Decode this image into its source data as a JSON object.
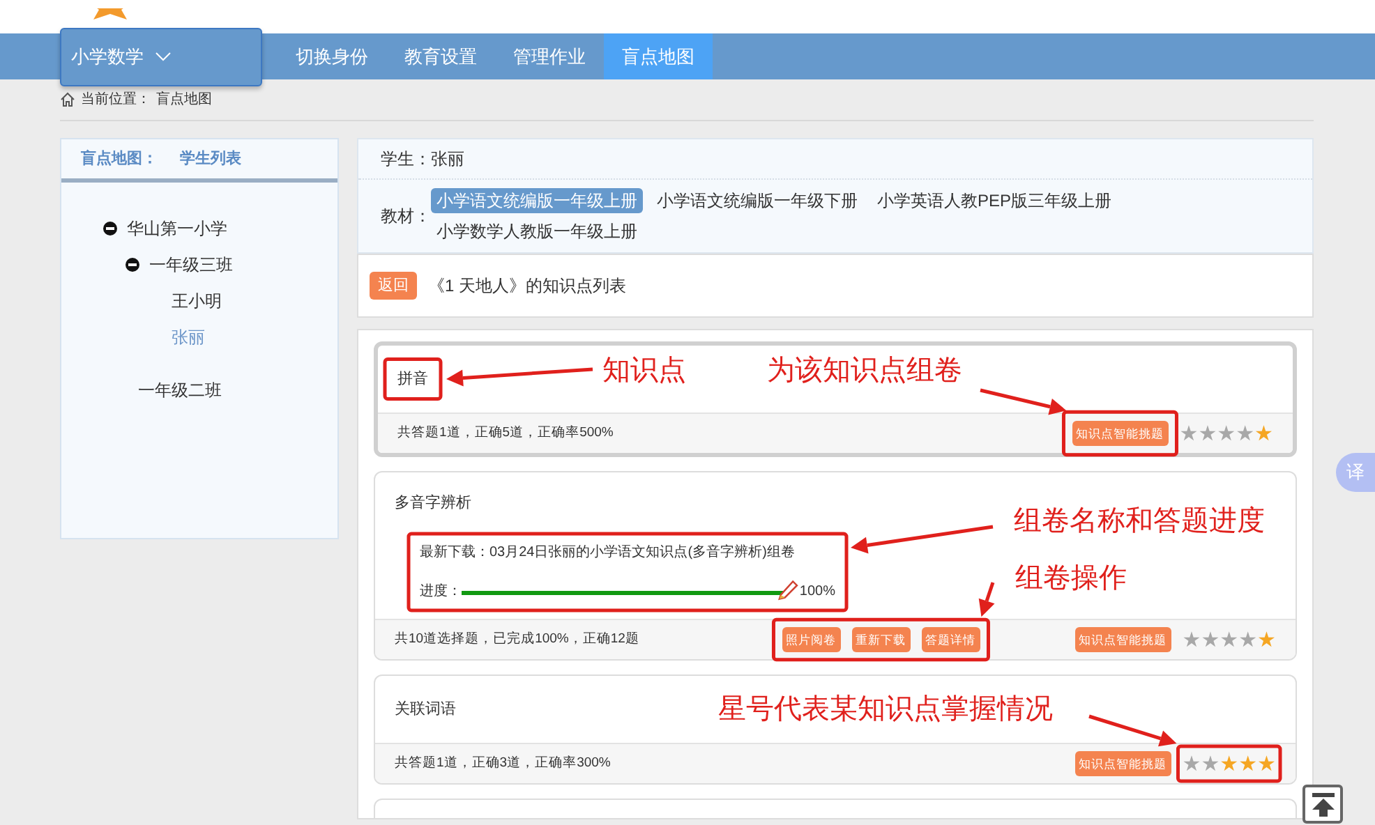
{
  "nav": {
    "subject": "小学数学",
    "items": [
      {
        "label": "切换身份",
        "selected": false
      },
      {
        "label": "教育设置",
        "selected": false
      },
      {
        "label": "管理作业",
        "selected": false
      },
      {
        "label": "盲点地图",
        "selected": true
      }
    ]
  },
  "breadcrumb": {
    "label": "当前位置：",
    "current": "盲点地图"
  },
  "sidebar": {
    "title": "盲点地图：",
    "subtitle": "学生列表",
    "tree": [
      {
        "label": "华山第一小学",
        "expanded": true,
        "children": [
          {
            "label": "一年级三班",
            "expanded": true,
            "children": [
              {
                "label": "王小明",
                "selected": false
              },
              {
                "label": "张丽",
                "selected": true
              }
            ]
          },
          {
            "label": "一年级二班"
          }
        ]
      }
    ]
  },
  "student": {
    "label": "学生：",
    "name": "张丽"
  },
  "textbooks": {
    "label": "教材：",
    "items": [
      {
        "label": "小学语文统编版一年级上册",
        "selected": true
      },
      {
        "label": "小学语文统编版一年级下册",
        "selected": false
      },
      {
        "label": "小学英语人教PEP版三年级上册",
        "selected": false
      },
      {
        "label": "小学数学人教版一年级上册",
        "selected": false
      }
    ]
  },
  "lesson": {
    "back": "返回",
    "title": "《1 天地人》的知识点列表"
  },
  "knowledge_points": [
    {
      "title": "拼音",
      "selected": true,
      "summary": "共答题1道，正确5道，正确率500%",
      "smart_button": "知识点智能挑题",
      "stars": 1
    },
    {
      "title": "多音字辨析",
      "selected": false,
      "download": {
        "label": "最新下载：",
        "name": "03月24日张丽的小学语文知识点(多音字辨析)组卷",
        "progress_label": "进度：",
        "level": 1,
        "reading": "100%"
      },
      "summary": "共10道选择题，已完成100%，正确12题",
      "actions": [
        "照片阅卷",
        "重新下载",
        "答题详情"
      ],
      "smart_button": "知识点智能挑题",
      "stars": 1
    },
    {
      "title": "关联词语",
      "selected": false,
      "summary": "共答题1道，正确3道，正确率300%",
      "smart_button": "知识点智能挑题",
      "stars": 3
    },
    {
      "selected": false
    }
  ],
  "annotations": [
    {
      "text": "知识点"
    },
    {
      "text": "为该知识点组卷"
    },
    {
      "text": "组卷名称和答题进度"
    },
    {
      "text": "组卷操作"
    },
    {
      "text": "星号代表某知识点掌握情况"
    }
  ],
  "translate_button": "译"
}
